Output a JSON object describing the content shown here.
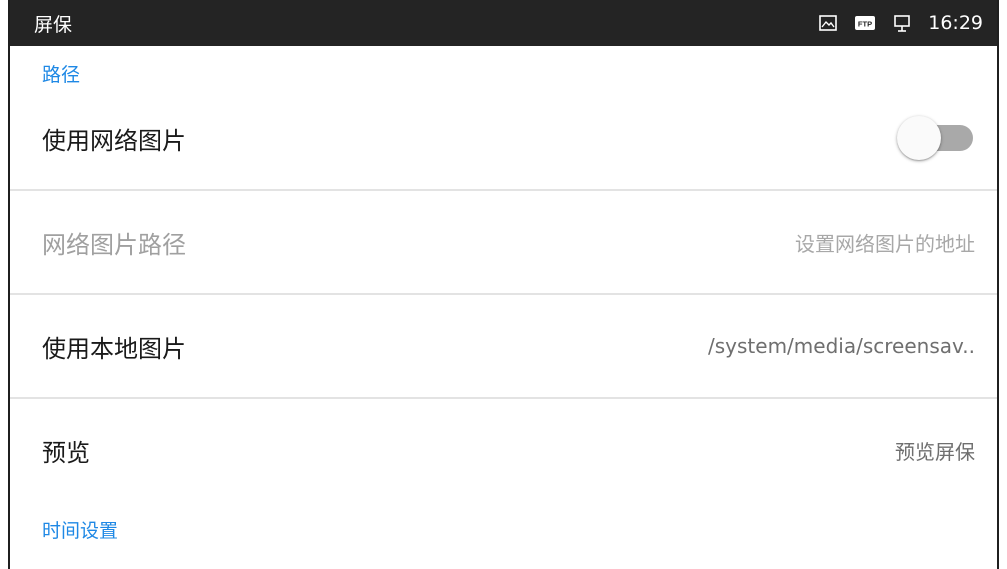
{
  "status_bar": {
    "title": "屏保",
    "time": "16:29",
    "icons": [
      "screenshot-icon",
      "ftp-icon",
      "ethernet-icon"
    ],
    "ftp_badge": "FTP"
  },
  "sections": {
    "path_header": "路径",
    "time_header": "时间设置"
  },
  "rows": {
    "use_network": {
      "label": "使用网络图片",
      "toggle_on": false
    },
    "network_path": {
      "label": "网络图片路径",
      "value": "设置网络图片的地址",
      "enabled": false
    },
    "use_local": {
      "label": "使用本地图片",
      "value": "/system/media/screensav.."
    },
    "preview": {
      "label": "预览",
      "value": "预览屏保"
    }
  },
  "colors": {
    "accent": "#1e88e5",
    "status_bar_bg": "#242424",
    "toggle_track_off": "#a9a9a9"
  }
}
